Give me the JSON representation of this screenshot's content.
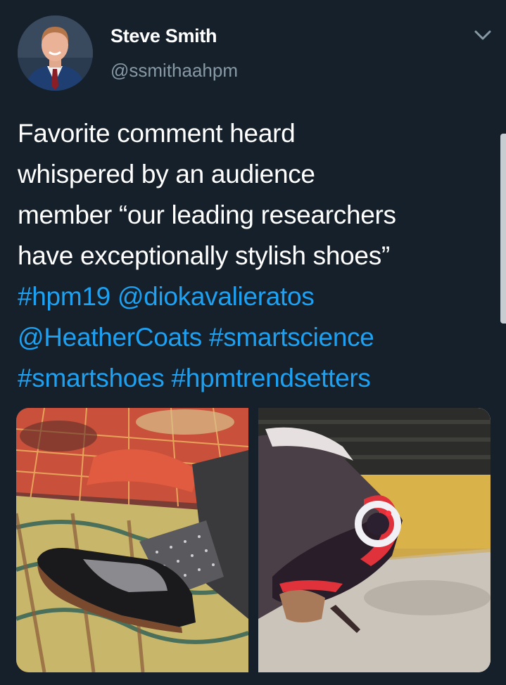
{
  "author": {
    "name": "Steve Smith",
    "handle": "@ssmithaahpm",
    "avatar_icon": "avatar-photo"
  },
  "tweet": {
    "line1": "Favorite comment heard",
    "line2": "whispered by an audience",
    "line3": "member “our leading researchers",
    "line4": "have exceptionally stylish shoes”",
    "tags": [
      "#hpm19",
      "@diokavalieratos",
      "@HeatherCoats",
      "#smartscience",
      "#smartshoes",
      "#hpmtrendsetters"
    ]
  },
  "icons": {
    "menu": "chevron-down-icon"
  },
  "colors": {
    "background": "#15202b",
    "text": "#ffffff",
    "link": "#1da1f2",
    "handle": "#8899a6"
  }
}
